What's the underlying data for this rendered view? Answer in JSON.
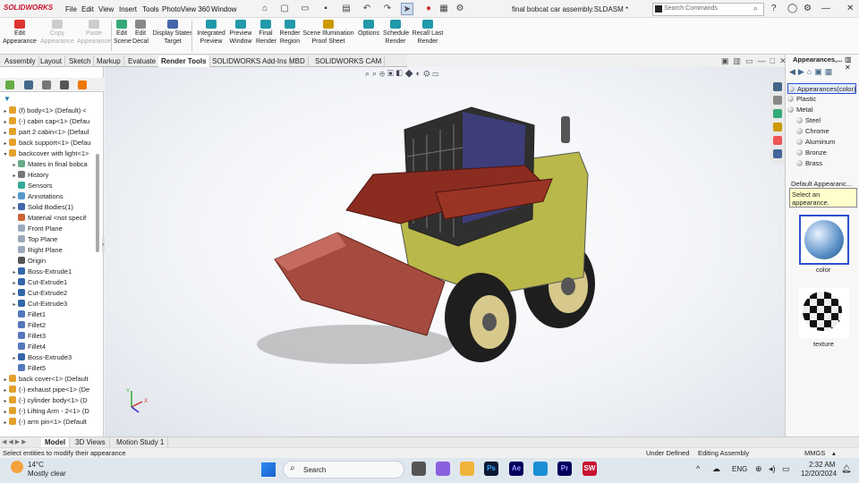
{
  "app": {
    "logo": "SOLIDWORKS",
    "document_title": "final bobcat car assembly.SLDASM *"
  },
  "menu": [
    "File",
    "Edit",
    "View",
    "Insert",
    "Tools",
    "PhotoView 360",
    "Window"
  ],
  "search": {
    "placeholder": "Search Commands"
  },
  "ribbon": [
    {
      "label": "Edit\nAppearance",
      "enabled": true,
      "icon": "edit-appearance-icon",
      "color": "#d33"
    },
    {
      "label": "Copy\nAppearance",
      "enabled": false,
      "icon": "copy-appearance-icon",
      "color": "#ccc"
    },
    {
      "label": "Paste\nAppearance",
      "enabled": false,
      "icon": "paste-appearance-icon",
      "color": "#ccc"
    },
    {
      "label": "Edit\nScene",
      "enabled": true,
      "icon": "edit-scene-icon",
      "color": "#3a7"
    },
    {
      "label": "Edit\nDecal",
      "enabled": true,
      "icon": "edit-decal-icon",
      "color": "#888"
    },
    {
      "label": "Display States\nTarget",
      "enabled": true,
      "icon": "display-states-icon",
      "color": "#46a"
    },
    {
      "label": "Integrated\nPreview",
      "enabled": true,
      "icon": "integrated-preview-icon",
      "color": "#29a"
    },
    {
      "label": "Preview\nWindow",
      "enabled": true,
      "icon": "preview-window-icon",
      "color": "#29a"
    },
    {
      "label": "Final\nRender",
      "enabled": true,
      "icon": "final-render-icon",
      "color": "#29a"
    },
    {
      "label": "Render\nRegion",
      "enabled": true,
      "icon": "render-region-icon",
      "color": "#29a"
    },
    {
      "label": "Scene Illumination\nProof Sheet",
      "enabled": true,
      "icon": "scene-illumination-icon",
      "color": "#c90"
    },
    {
      "label": "Options",
      "enabled": true,
      "icon": "options-icon",
      "color": "#29a"
    },
    {
      "label": "Schedule\nRender",
      "enabled": true,
      "icon": "schedule-render-icon",
      "color": "#29a"
    },
    {
      "label": "Recall Last\nRender",
      "enabled": true,
      "icon": "recall-render-icon",
      "color": "#29a"
    }
  ],
  "tabs": [
    {
      "label": "Assembly",
      "active": false
    },
    {
      "label": "Layout",
      "active": false
    },
    {
      "label": "Sketch",
      "active": false
    },
    {
      "label": "Markup",
      "active": false
    },
    {
      "label": "Evaluate",
      "active": false
    },
    {
      "label": "Render Tools",
      "active": true
    },
    {
      "label": "SOLIDWORKS Add-Ins",
      "active": false
    },
    {
      "label": "MBD",
      "active": false
    },
    {
      "label": "SOLIDWORKS CAM",
      "active": false
    }
  ],
  "tree": [
    {
      "label": "(f) body<1> (Default) <",
      "indent": 0,
      "exp": "▸",
      "icon": "part-icon"
    },
    {
      "label": "(-) cabin cap<1> (Defau",
      "indent": 0,
      "exp": "▸",
      "icon": "part-icon"
    },
    {
      "label": "part 2 cabin<1> (Defaul",
      "indent": 0,
      "exp": "▸",
      "icon": "part-icon"
    },
    {
      "label": "back support<1> (Defau",
      "indent": 0,
      "exp": "▸",
      "icon": "part-icon"
    },
    {
      "label": "backcover with light<1>",
      "indent": 0,
      "exp": "▾",
      "icon": "part-icon"
    },
    {
      "label": "Mates in final bobca",
      "indent": 1,
      "exp": "▸",
      "icon": "mates-icon"
    },
    {
      "label": "History",
      "indent": 1,
      "exp": "▸",
      "icon": "history-icon"
    },
    {
      "label": "Sensors",
      "indent": 1,
      "exp": "",
      "icon": "sensors-icon"
    },
    {
      "label": "Annotations",
      "indent": 1,
      "exp": "▸",
      "icon": "annotations-icon"
    },
    {
      "label": "Solid Bodies(1)",
      "indent": 1,
      "exp": "▸",
      "icon": "solid-bodies-icon"
    },
    {
      "label": "Material <not specif",
      "indent": 1,
      "exp": "",
      "icon": "material-icon"
    },
    {
      "label": "Front Plane",
      "indent": 1,
      "exp": "",
      "icon": "plane-icon"
    },
    {
      "label": "Top Plane",
      "indent": 1,
      "exp": "",
      "icon": "plane-icon"
    },
    {
      "label": "Right Plane",
      "indent": 1,
      "exp": "",
      "icon": "plane-icon"
    },
    {
      "label": "Origin",
      "indent": 1,
      "exp": "",
      "icon": "origin-icon"
    },
    {
      "label": "Boss-Extrude1",
      "indent": 1,
      "exp": "▸",
      "icon": "extrude-icon"
    },
    {
      "label": "Cut-Extrude1",
      "indent": 1,
      "exp": "▸",
      "icon": "extrude-icon"
    },
    {
      "label": "Cut-Extrude2",
      "indent": 1,
      "exp": "▸",
      "icon": "extrude-icon"
    },
    {
      "label": "Cut-Extrude3",
      "indent": 1,
      "exp": "▸",
      "icon": "extrude-icon"
    },
    {
      "label": "Fillet1",
      "indent": 1,
      "exp": "",
      "icon": "fillet-icon"
    },
    {
      "label": "Fillet2",
      "indent": 1,
      "exp": "",
      "icon": "fillet-icon"
    },
    {
      "label": "Fillet3",
      "indent": 1,
      "exp": "",
      "icon": "fillet-icon"
    },
    {
      "label": "Fillet4",
      "indent": 1,
      "exp": "",
      "icon": "fillet-icon"
    },
    {
      "label": "Boss-Extrude3",
      "indent": 1,
      "exp": "▸",
      "icon": "extrude-icon"
    },
    {
      "label": "Fillet5",
      "indent": 1,
      "exp": "",
      "icon": "fillet-icon"
    },
    {
      "label": "back cover<1> (Default",
      "indent": 0,
      "exp": "▸",
      "icon": "part-icon"
    },
    {
      "label": "(-) exhaust pipe<1> (De",
      "indent": 0,
      "exp": "▸",
      "icon": "part-icon"
    },
    {
      "label": "(-) cylinder body<1> (D",
      "indent": 0,
      "exp": "▸",
      "icon": "part-icon"
    },
    {
      "label": "(-) Lifting Arm - 2<1> (D",
      "indent": 0,
      "exp": "▸",
      "icon": "part-icon"
    },
    {
      "label": "(-) arm pin<1> (Default",
      "indent": 0,
      "exp": "▸",
      "icon": "part-icon"
    }
  ],
  "appearances": {
    "header": "Appearances,...",
    "items": [
      {
        "label": "Appearances(color)",
        "indent": 0,
        "selected": true
      },
      {
        "label": "Plastic",
        "indent": 0,
        "selected": false
      },
      {
        "label": "Metal",
        "indent": 0,
        "selected": false
      },
      {
        "label": "Steel",
        "indent": 1,
        "selected": false
      },
      {
        "label": "Chrome",
        "indent": 1,
        "selected": false
      },
      {
        "label": "Aluminum",
        "indent": 1,
        "selected": false
      },
      {
        "label": "Bronze",
        "indent": 1,
        "selected": false
      },
      {
        "label": "Brass",
        "indent": 1,
        "selected": false
      }
    ],
    "default_label": "Default Appearanc...",
    "tooltip": "Select an appearance.",
    "swatch_color_label": "color",
    "swatch_texture_label": "texture"
  },
  "bottom_tabs": [
    {
      "label": "Model",
      "active": true
    },
    {
      "label": "3D Views",
      "active": false
    },
    {
      "label": "Motion Study 1",
      "active": false
    }
  ],
  "status": {
    "message": "Select entities to modify their appearance",
    "state": "Under Defined",
    "mode": "Editing Assembly",
    "units": "MMGS"
  },
  "taskbar": {
    "weather_temp": "14°C",
    "weather_desc": "Mostly clear",
    "search_placeholder": "Search",
    "lang": "ENG",
    "time": "2:32 AM",
    "date": "12/20/2024"
  },
  "triad": {
    "x": "X",
    "y": "Y"
  }
}
